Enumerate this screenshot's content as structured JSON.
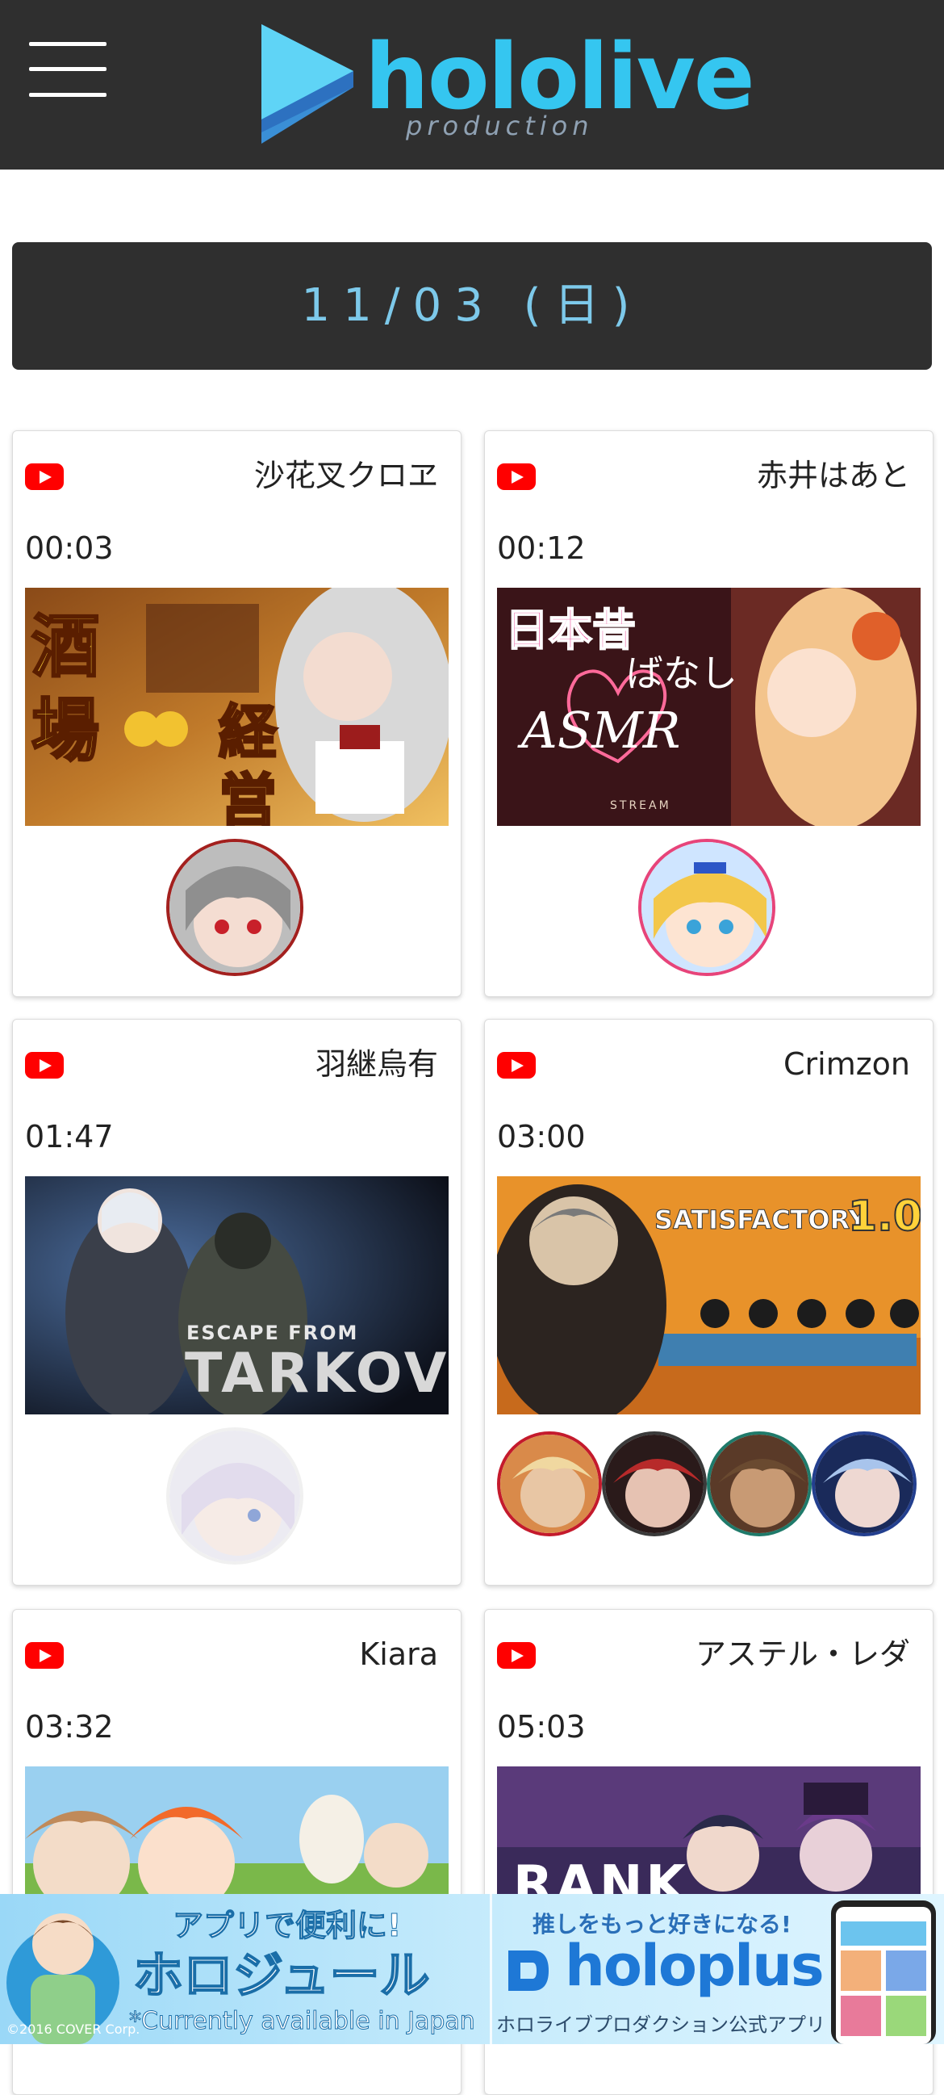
{
  "header": {
    "logo_text": "hololive",
    "logo_sub": "production",
    "menu_icon": "hamburger-menu-icon"
  },
  "date": "11/03 (日)",
  "colors": {
    "header_bg": "#2f2f2f",
    "accent": "#35c6f0",
    "youtube_red": "#ff0000"
  },
  "schedule": [
    {
      "name": "沙花叉クロヱ",
      "time": "00:03",
      "platform": "youtube",
      "thumb_text": [
        "酒",
        "場",
        "経",
        "営"
      ]
    },
    {
      "name": "赤井はあと",
      "time": "00:12",
      "platform": "youtube",
      "thumb_text": [
        "日本昔",
        "ばなし",
        "ASMR",
        "STREAM"
      ]
    },
    {
      "name": "羽継烏有",
      "time": "01:47",
      "platform": "youtube",
      "thumb_text": [
        "ESCAPE FROM",
        "TARKOV"
      ]
    },
    {
      "name": "Crimzon",
      "time": "03:00",
      "platform": "youtube",
      "thumb_text": [
        "SATISFACTORY",
        "1.0"
      ]
    },
    {
      "name": "Kiara",
      "time": "03:32",
      "platform": "youtube",
      "thumb_text": []
    },
    {
      "name": "アステル・レダ",
      "time": "05:03",
      "platform": "youtube",
      "thumb_text": [
        "RANK"
      ]
    }
  ],
  "banner": {
    "tagline": "アプリで便利に!",
    "app_name": "ホロジュール",
    "note": "*Currently available in Japan",
    "copyright": "©2016 COVER Corp.",
    "promo_tagline": "推しをもっと好きになる!",
    "promo_logo": "holoplus",
    "promo_sub": "ホロライブプロダクション公式アプリ"
  }
}
